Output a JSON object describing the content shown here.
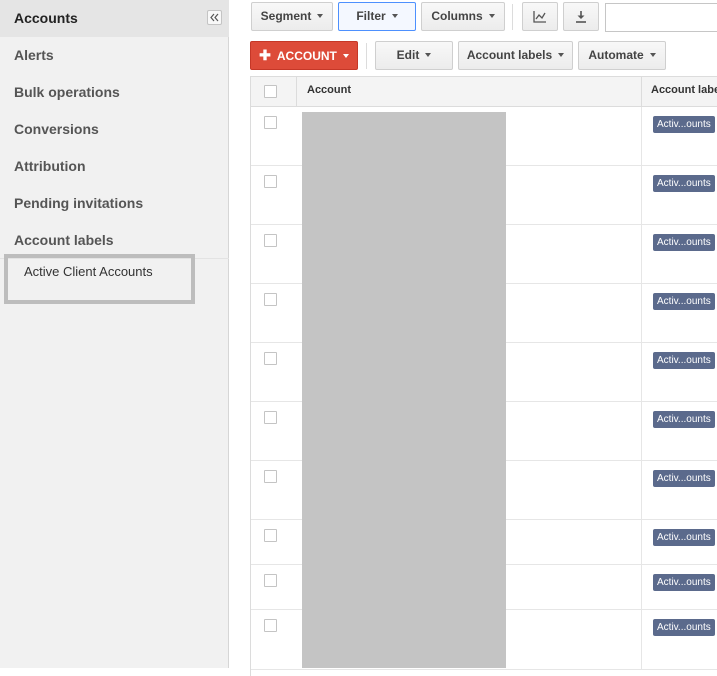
{
  "sidebar": {
    "collapse_icon": "double-chevron-left-icon",
    "items": [
      {
        "label": "Accounts",
        "active": true
      },
      {
        "label": "Alerts"
      },
      {
        "label": "Bulk operations"
      },
      {
        "label": "Conversions"
      },
      {
        "label": "Attribution"
      },
      {
        "label": "Pending invitations"
      },
      {
        "label": "Account labels"
      }
    ],
    "label_items": [
      "Active Client Accounts"
    ]
  },
  "toolbar": {
    "segment": "Segment",
    "filter": "Filter",
    "columns": "Columns",
    "chart_icon": "chart-icon",
    "download_icon": "download-icon",
    "search_placeholder": ""
  },
  "actions": {
    "add_account": "ACCOUNT",
    "edit": "Edit",
    "account_labels": "Account labels",
    "automate": "Automate"
  },
  "table": {
    "columns": [
      "Account",
      "Account labels"
    ],
    "rows": [
      {
        "label": "Activ...ounts"
      },
      {
        "label": "Activ...ounts"
      },
      {
        "label": "Activ...ounts"
      },
      {
        "label": "Activ...ounts"
      },
      {
        "label": "Activ...ounts"
      },
      {
        "label": "Activ...ounts"
      },
      {
        "label": "Activ...ounts"
      },
      {
        "label": "Activ...ounts"
      },
      {
        "label": "Activ...ounts"
      },
      {
        "label": "Activ...ounts"
      }
    ]
  },
  "colors": {
    "accent_red": "#dd4b39",
    "badge": "#5b6a8c",
    "focus_blue": "#4d90fe"
  }
}
